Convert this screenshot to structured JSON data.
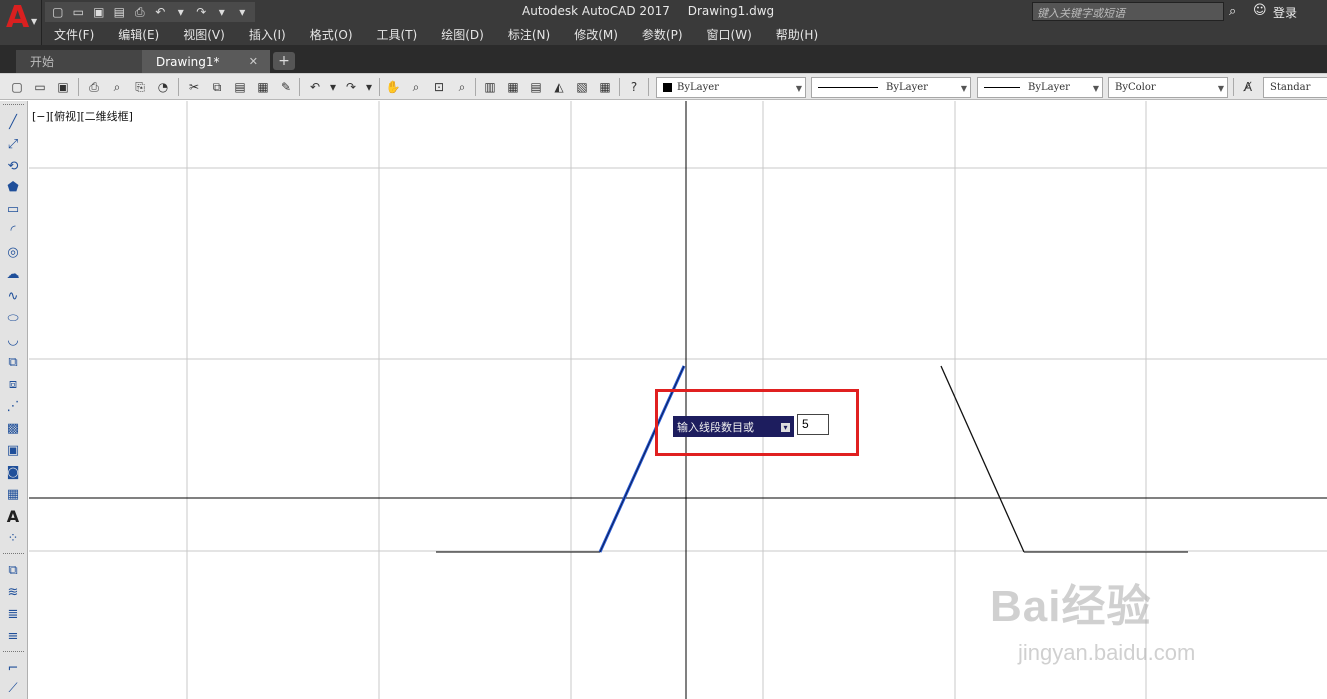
{
  "window": {
    "app_name": "Autodesk AutoCAD 2017",
    "document": "Drawing1.dwg"
  },
  "search": {
    "placeholder": "键入关键字或短语"
  },
  "account": {
    "login_label": "登录"
  },
  "menu": [
    "文件(F)",
    "编辑(E)",
    "视图(V)",
    "插入(I)",
    "格式(O)",
    "工具(T)",
    "绘图(D)",
    "标注(N)",
    "修改(M)",
    "参数(P)",
    "窗口(W)",
    "帮助(H)"
  ],
  "tabs": {
    "start": "开始",
    "drawing": "Drawing1*",
    "close_glyph": "✕",
    "add_glyph": "+"
  },
  "properties": {
    "color": "ByLayer",
    "linetype": "ByLayer",
    "lineweight": "ByLayer",
    "plotstyle": "ByColor",
    "textstyle": "Standar"
  },
  "viewport": {
    "label": "[−][俯视][二维线框]"
  },
  "dynamic_input": {
    "prompt": "输入线段数目或",
    "value": "5"
  },
  "watermark": {
    "logo": "Bai经验",
    "url": "jingyan.baidu.com"
  },
  "colors": {
    "titlebar": "#3a3a3a",
    "toolbar": "#e8e8e8",
    "selected_line": "#2a5bd7",
    "highlight": "#e02020",
    "prompt_bg": "#1d1d5e"
  }
}
